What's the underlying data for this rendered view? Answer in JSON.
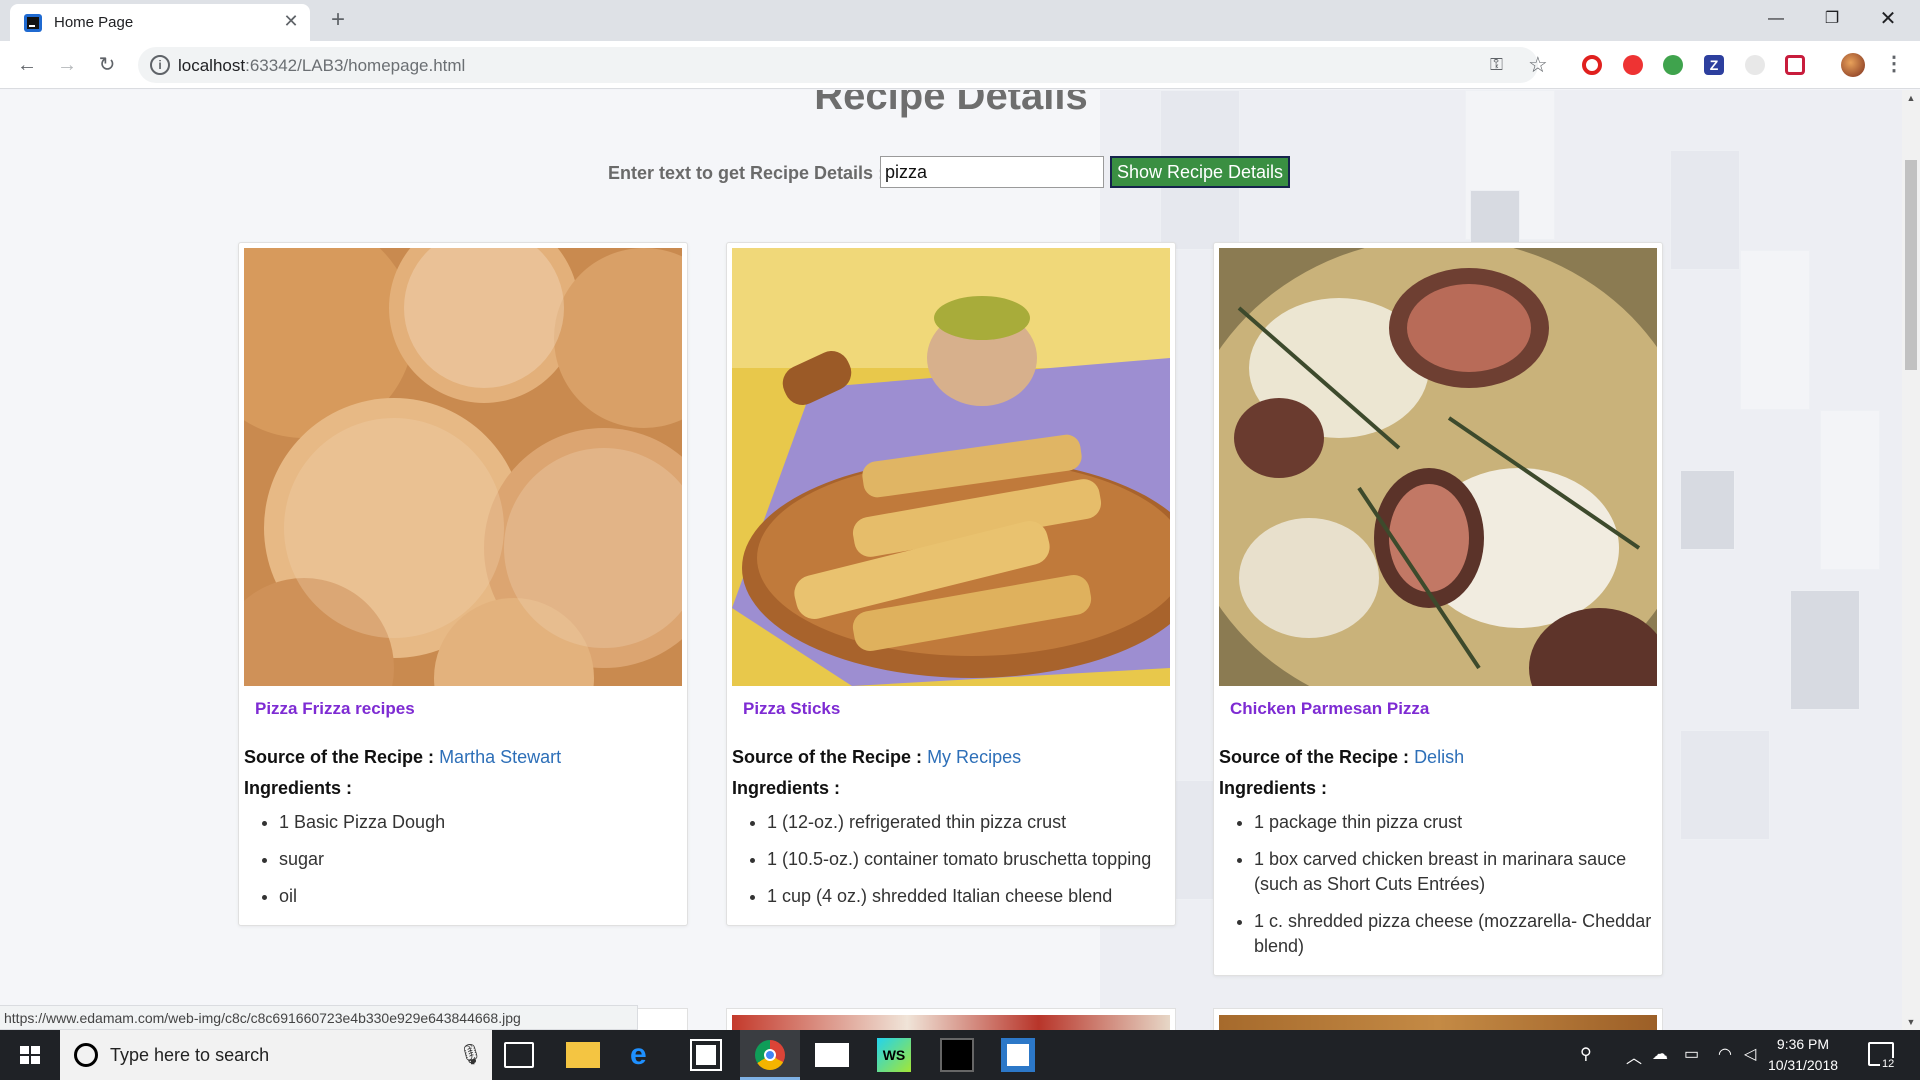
{
  "browser": {
    "tab_title": "Home Page",
    "url_host": "localhost",
    "url_path": ":63342/LAB3/homepage.html",
    "status_url": "https://www.edamam.com/web-img/c8c/c8c691660723e4b330e929e643844668.jpg"
  },
  "page": {
    "title": "Recipe Details",
    "search_label": "Enter text to get Recipe Details :",
    "search_value": "pizza",
    "button_label": "Show Recipe Details",
    "source_prefix": "Source of the Recipe :",
    "ingredients_heading": "Ingredients :"
  },
  "recipes": [
    {
      "name": "Pizza Frizza recipes",
      "source": "Martha Stewart",
      "ingredients": [
        "1 Basic Pizza Dough",
        "sugar",
        "oil"
      ]
    },
    {
      "name": "Pizza Sticks",
      "source": "My Recipes",
      "ingredients": [
        "1 (12-oz.) refrigerated thin pizza crust",
        "1 (10.5-oz.) container tomato bruschetta topping",
        "1 cup (4 oz.) shredded Italian cheese blend"
      ]
    },
    {
      "name": "Chicken Parmesan Pizza",
      "source": "Delish",
      "ingredients": [
        "1 package thin pizza crust",
        "1 box carved chicken breast in marinara sauce (such as Short Cuts Entrées)",
        "1 c. shredded pizza cheese (mozzarella- Cheddar blend)"
      ]
    }
  ],
  "taskbar": {
    "search_placeholder": "Type here to search",
    "time": "9:36 PM",
    "date": "10/31/2018",
    "notification_count": "12"
  },
  "colors": {
    "title_link": "#7e2bd3",
    "source_link": "#2d6fb8",
    "button_bg": "#3a8f42"
  }
}
